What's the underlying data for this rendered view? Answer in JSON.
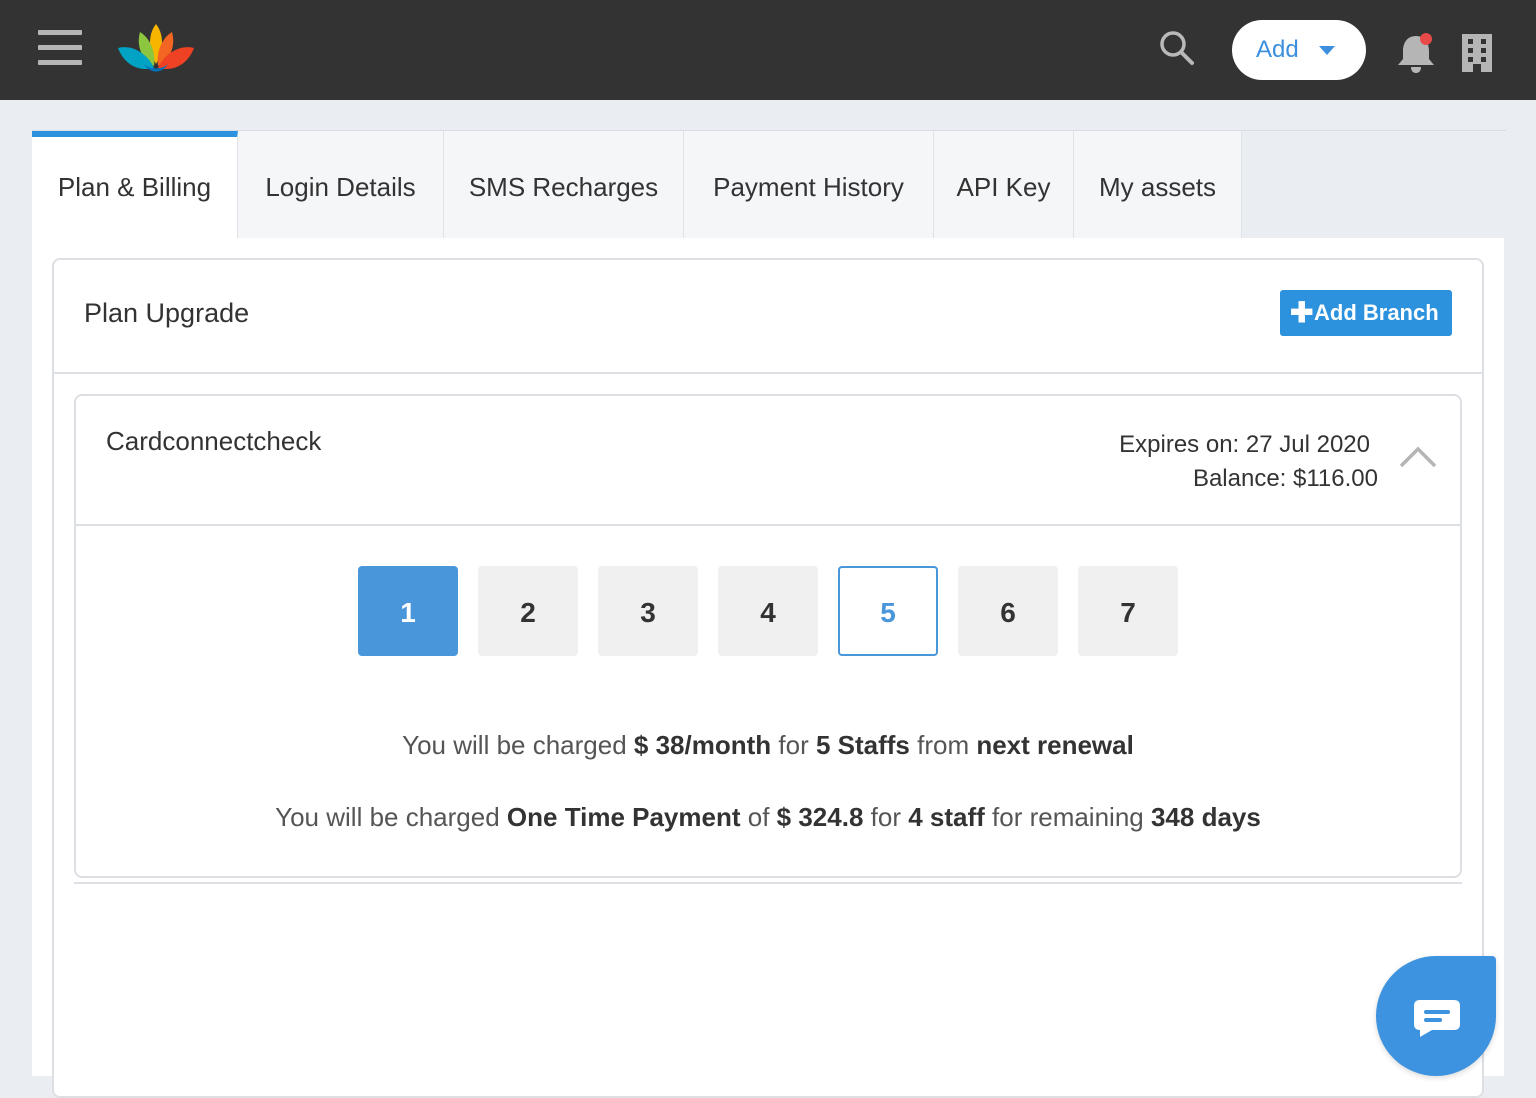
{
  "header": {
    "menu_icon": "hamburger-menu-icon",
    "logo_icon": "lotus-logo-icon",
    "search_icon": "search-icon",
    "add_button_label": "Add",
    "notifications_icon": "bell-icon",
    "business_icon": "building-icon",
    "colors": {
      "bar": "#333333",
      "accent": "#3b8fdc",
      "notification_dot": "#e84a4a"
    }
  },
  "tabs": [
    {
      "label": "Plan & Billing",
      "active": true
    },
    {
      "label": "Login Details",
      "active": false
    },
    {
      "label": "SMS Recharges",
      "active": false
    },
    {
      "label": "Payment History",
      "active": false
    },
    {
      "label": "API Key",
      "active": false
    },
    {
      "label": "My assets",
      "active": false
    }
  ],
  "plan": {
    "title": "Plan Upgrade",
    "add_branch_label": "Add Branch"
  },
  "branch": {
    "name": "Cardconnectcheck",
    "expires_label": "Expires on:",
    "expires_value": "27 Jul 2020",
    "balance_label": "Balance:",
    "balance_value": "$116.00",
    "staff_options": [
      "1",
      "2",
      "3",
      "4",
      "5",
      "6",
      "7"
    ],
    "selected_option": "1",
    "highlighted_option": "5",
    "charge_monthly": {
      "t1": "You will be charged ",
      "amount": "$ 38/month",
      "t2": " for ",
      "staffs": "5 Staffs",
      "t3": " from ",
      "when": "next renewal"
    },
    "charge_one_time": {
      "t1": "You will be charged ",
      "type": "One Time Payment",
      "t2": " of ",
      "amount": "$ 324.8",
      "t3": " for ",
      "staff": "4 staff",
      "t4": " for remaining ",
      "days": "348 days"
    }
  },
  "chat": {
    "icon": "chat-bubble-icon",
    "color": "#3d93e0"
  }
}
